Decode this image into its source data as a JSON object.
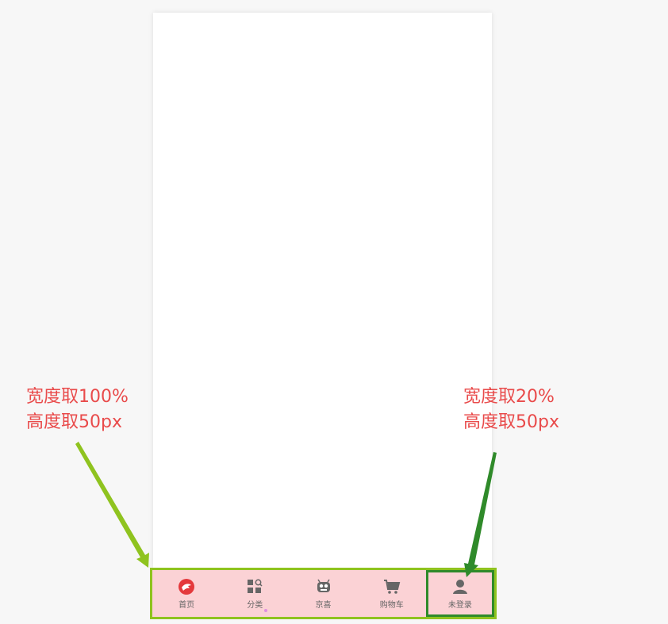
{
  "annotations": {
    "left": {
      "line1": "宽度取100%",
      "line2": "高度取50px",
      "color": "#e94b4b"
    },
    "right": {
      "line1": "宽度取20%",
      "line2": "高度取50px",
      "color": "#e94b4b"
    }
  },
  "tabbar": {
    "background": "#fbd2d5",
    "border_color": "#8fc31f",
    "highlight_color": "#2f8a2a",
    "items": [
      {
        "label": "首页",
        "icon": "home-logo-icon"
      },
      {
        "label": "分类",
        "icon": "category-grid-icon"
      },
      {
        "label": "京喜",
        "icon": "jingxi-icon"
      },
      {
        "label": "购物车",
        "icon": "cart-icon"
      },
      {
        "label": "未登录",
        "icon": "user-icon"
      }
    ]
  },
  "arrows": {
    "left_color": "#8fc31f",
    "right_color": "#2f8a2a"
  }
}
